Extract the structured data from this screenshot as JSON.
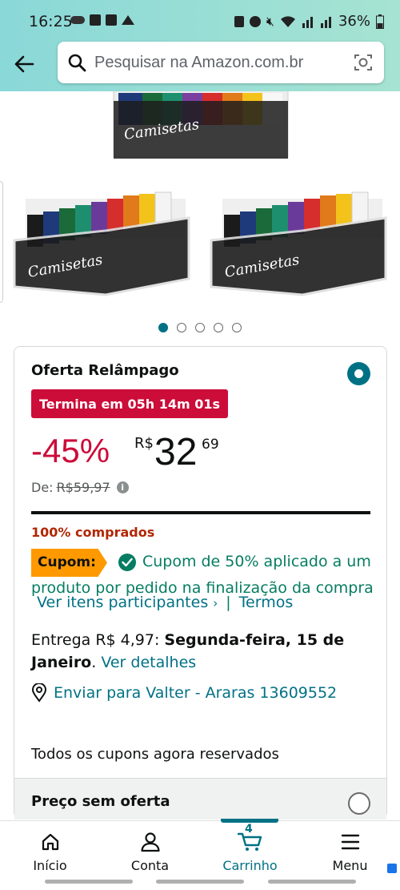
{
  "status_bar": {
    "time": "16:25",
    "battery": "36%"
  },
  "search": {
    "placeholder": "Pesquisar na Amazon.com.br"
  },
  "product_images": {
    "label": "Camisetas",
    "dot_count": 5,
    "active_dot": 0
  },
  "offer": {
    "title": "Oferta Relâmpago",
    "deal_badge": "Termina em 05h 14m 01s",
    "discount": "-45%",
    "currency": "R$",
    "price_whole": "32",
    "price_fraction": "69",
    "list_price_label": "De:",
    "list_price": "R$59,97",
    "claimed_text": "100% comprados",
    "claimed_fraction": 1.0,
    "coupon_tag": "Cupom:",
    "coupon_text": "Cupom de 50% aplicado a um produto por pedido na finalização da compra",
    "coupon_link_items": "Ver itens participantes",
    "coupon_link_terms": "Termos",
    "delivery_prefix": "Entrega R$ 4,97: ",
    "delivery_date": "Segunda-feira, 15 de Janeiro",
    "delivery_details_link": "Ver detalhes",
    "ship_to": "Enviar para Valter - Araras 13609552",
    "all_coupons": "Todos os cupons agora reservados",
    "no_deal_label": "Preço sem oferta"
  },
  "bottom_nav": {
    "items": [
      {
        "label": "Início",
        "icon": "home-icon"
      },
      {
        "label": "Conta",
        "icon": "person-icon"
      },
      {
        "label": "Carrinho",
        "icon": "cart-icon"
      },
      {
        "label": "Menu",
        "icon": "menu-icon"
      }
    ],
    "cart_count": "4"
  },
  "colors": {
    "accent_teal": "#007185",
    "deal_red": "#cc0c39",
    "coupon_orange": "#ff9900",
    "success_green": "#067d62",
    "header_gradient": "#8ad8d8"
  }
}
